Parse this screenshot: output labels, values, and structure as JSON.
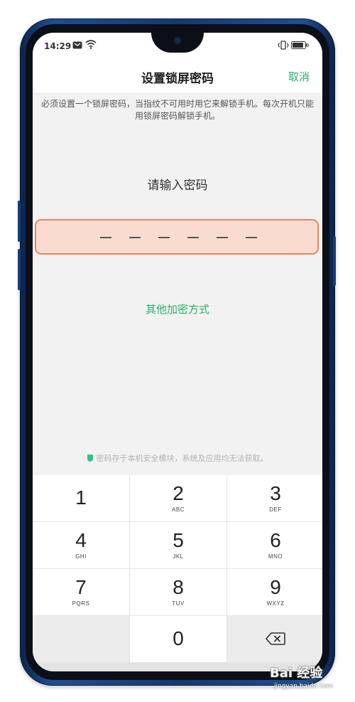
{
  "status_bar": {
    "time": "14:29",
    "icons": [
      "message-icon",
      "wifi-icon",
      "vibrate-icon",
      "battery-icon"
    ]
  },
  "header": {
    "title": "设置锁屏密码",
    "cancel_label": "取消"
  },
  "description": "必须设置一个锁屏密码，当指纹不可用时用它来解锁手机。每次开机只能用锁屏密码解锁手机。",
  "prompt": "请输入密码",
  "password": {
    "length": 6,
    "entered": 0
  },
  "other_methods_label": "其他加密方式",
  "security_note": "密码存于本机安全模块，系统及应用均无法获取。",
  "keypad": {
    "keys": [
      {
        "num": "1",
        "letters": ""
      },
      {
        "num": "2",
        "letters": "ABC"
      },
      {
        "num": "3",
        "letters": "DEF"
      },
      {
        "num": "4",
        "letters": "GHI"
      },
      {
        "num": "5",
        "letters": "JKL"
      },
      {
        "num": "6",
        "letters": "MNO"
      },
      {
        "num": "7",
        "letters": "PQRS"
      },
      {
        "num": "8",
        "letters": "TUV"
      },
      {
        "num": "9",
        "letters": "WXYZ"
      },
      {
        "num": "0",
        "letters": ""
      }
    ]
  },
  "watermark": {
    "main": "Bai 经验",
    "sub": "jingyan.baidu.com"
  },
  "colors": {
    "accent": "#28b26b",
    "input_bg": "#f9dccf",
    "input_border": "#e9855d",
    "frame": "#1f4f93"
  }
}
